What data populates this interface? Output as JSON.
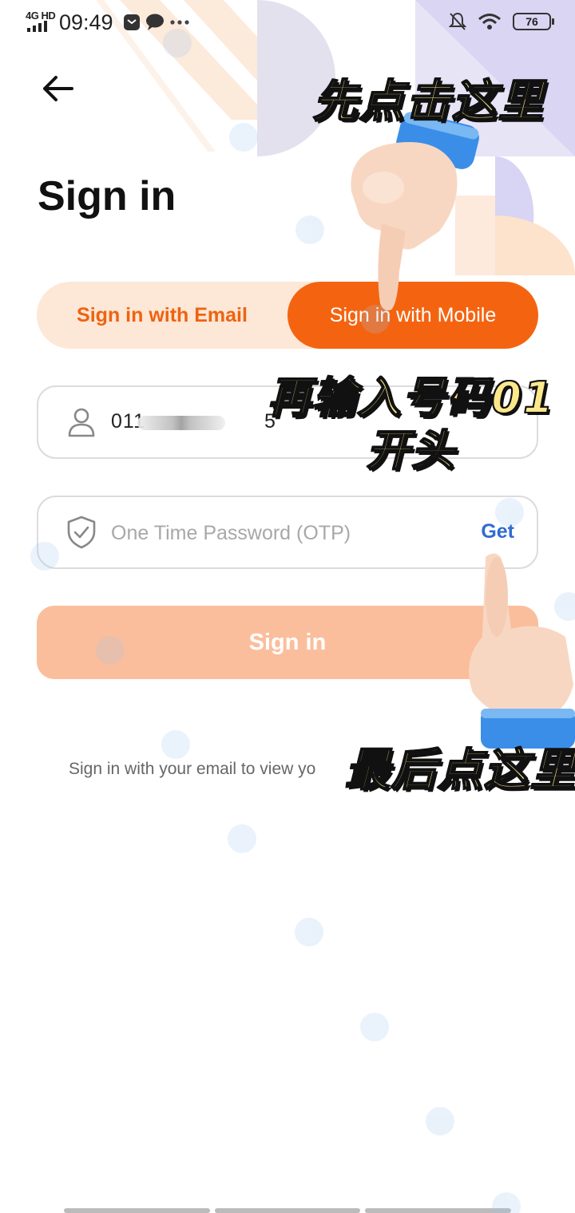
{
  "status_bar": {
    "network": "4G HD",
    "time": "09:49",
    "battery": "76"
  },
  "header": {
    "back_icon": "arrow-left-icon",
    "title": "Sign in"
  },
  "tabs": [
    {
      "label": "Sign in with Email",
      "selected": false
    },
    {
      "label": "Sign in with Mobile",
      "selected": true
    }
  ],
  "form": {
    "phone": {
      "icon": "user-icon",
      "value_prefix": "011",
      "value_suffix": "5"
    },
    "otp": {
      "icon": "shield-check-icon",
      "placeholder": "One Time Password (OTP)",
      "action": "Get"
    },
    "submit": "Sign in",
    "hint": "Sign in with your email to view yo"
  },
  "annotations": {
    "step1": "先点击这里",
    "step2_line1": "再输入号码01",
    "step2_line2": "开头",
    "step3": "最后点这里"
  },
  "colors": {
    "accent": "#f46410",
    "accent_light": "#fde7d7",
    "button_disabled": "#fbbe9c",
    "link": "#2f6bd3"
  }
}
